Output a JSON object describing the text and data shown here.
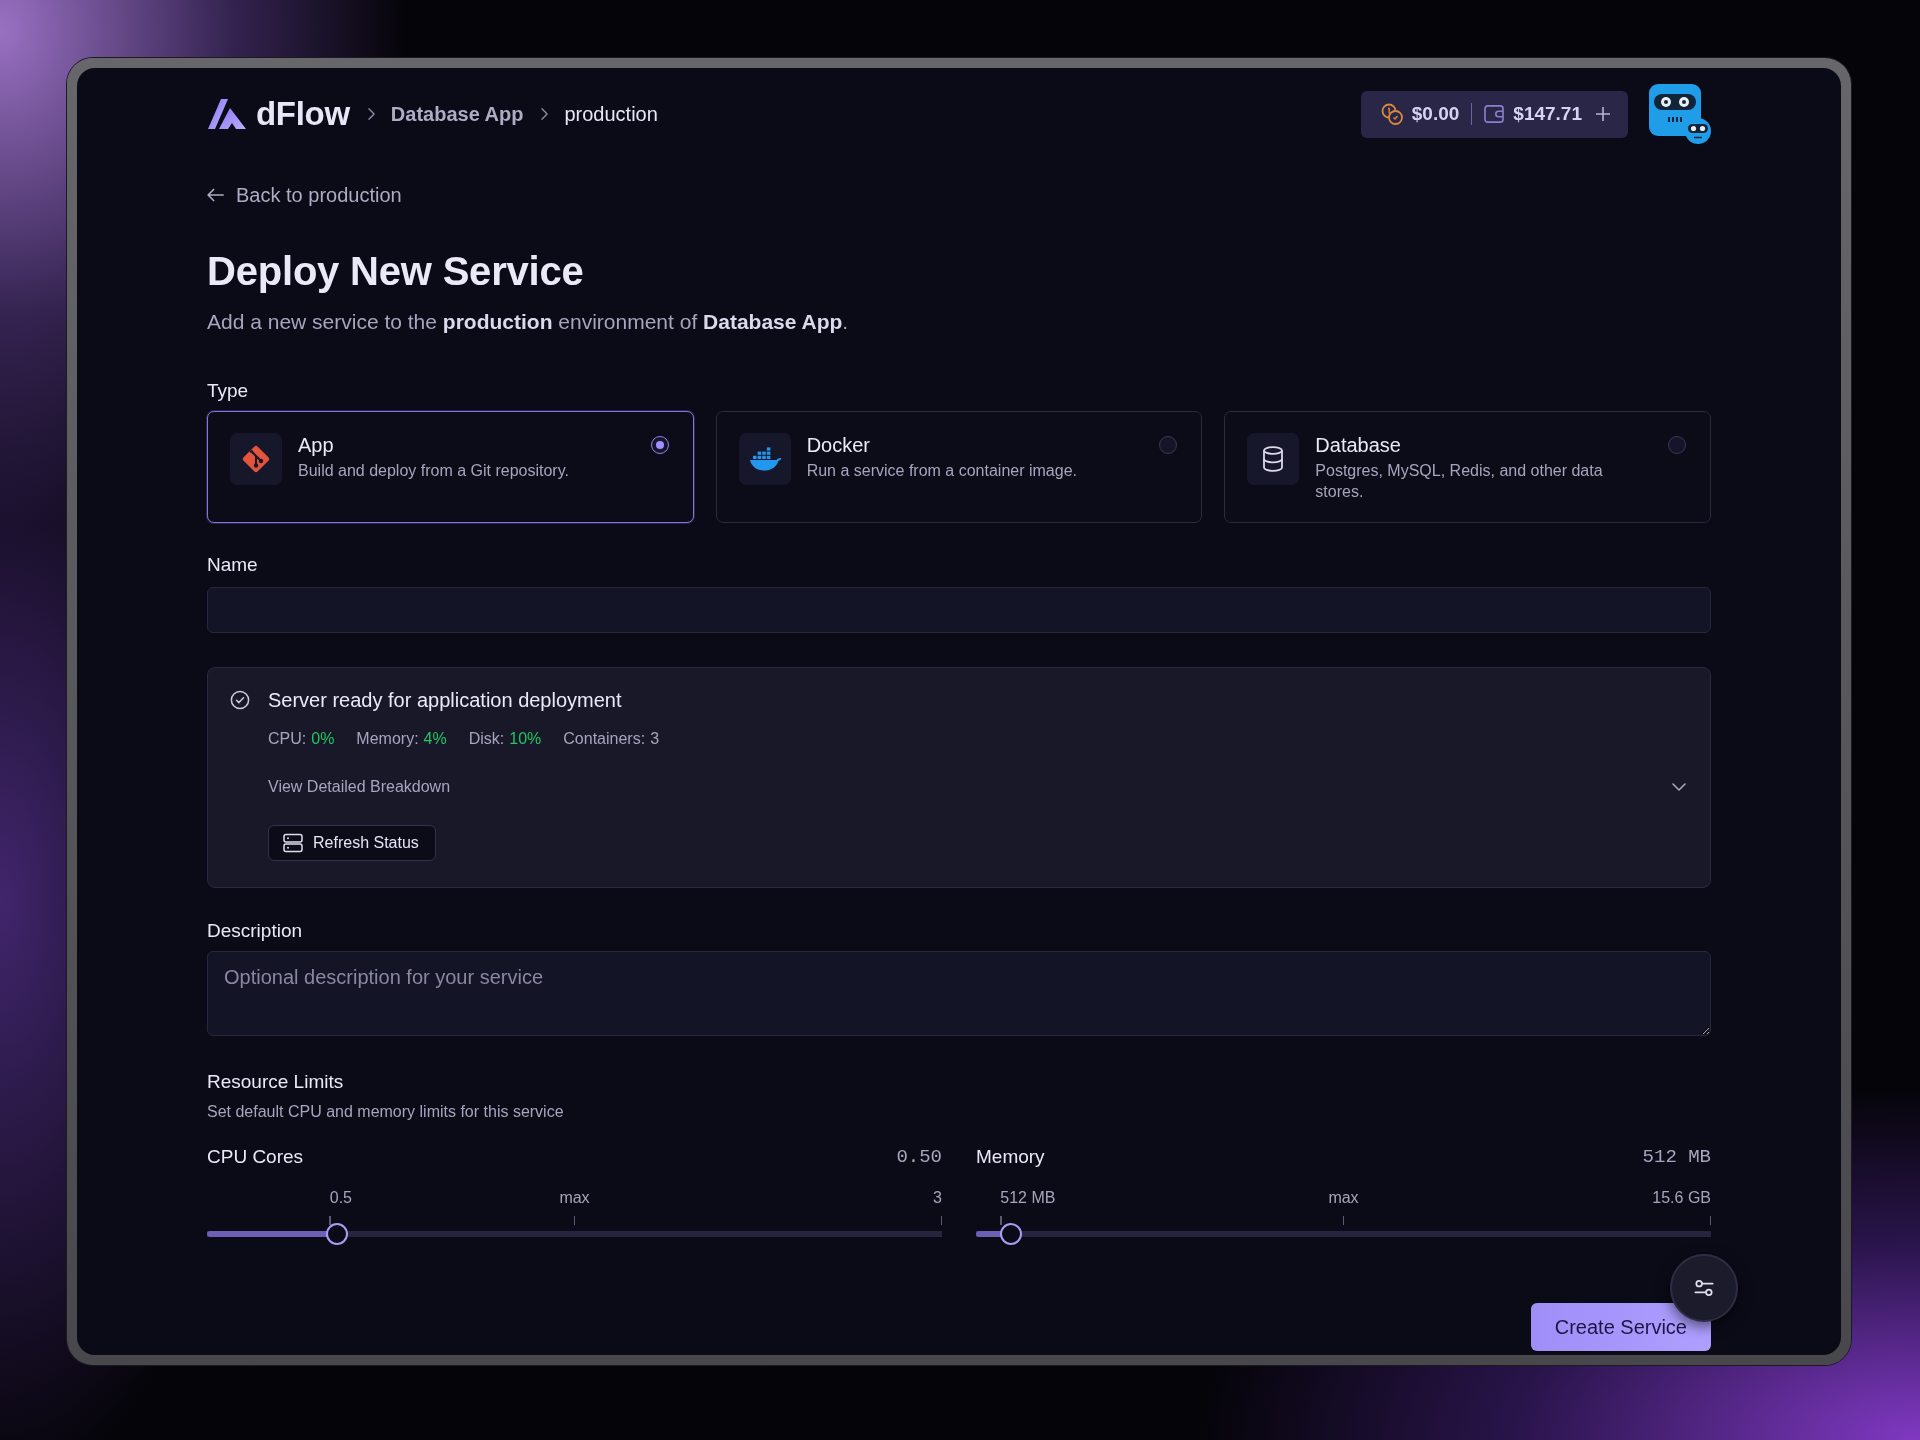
{
  "header": {
    "logo": "dFlow",
    "breadcrumbs": [
      {
        "label": "Database App",
        "current": false
      },
      {
        "label": "production",
        "current": true
      }
    ],
    "balance": {
      "credits": "$0.00",
      "wallet": "$147.71"
    }
  },
  "back_link": "Back to production",
  "page": {
    "title": "Deploy New Service",
    "subtitle": "Add a new service to the **production** environment of **Database App**."
  },
  "service_type": {
    "label": "Type",
    "options": [
      {
        "kind": "git",
        "title": "App",
        "description": "Build and deploy from a Git repository.",
        "selected": true
      },
      {
        "kind": "docker",
        "title": "Docker",
        "description": "Run a service from a container image.",
        "selected": false
      },
      {
        "kind": "database",
        "title": "Database",
        "description": "Postgres, MySQL, Redis, and other data stores.",
        "selected": false
      }
    ]
  },
  "name_field": {
    "label": "Name"
  },
  "server_status": {
    "title": "Server ready for application deployment",
    "metrics": [
      {
        "label": "CPU:",
        "value": "0%",
        "color": "#22c55e"
      },
      {
        "label": "Memory:",
        "value": "4%",
        "color": "#22c55e"
      },
      {
        "label": "Disk:",
        "value": "10%",
        "color": "#22c55e"
      },
      {
        "label": "Containers:",
        "value": "3",
        "color": "#a7a4bd"
      }
    ],
    "details_toggle": "View Detailed Breakdown",
    "expanded": false,
    "refresh_button": "Refresh Status"
  },
  "description_field": {
    "label": "Description",
    "placeholder": "Optional description for your service"
  },
  "resource_limits": {
    "title": "Resource Limits",
    "subtitle": "Set default CPU and memory limits for this service",
    "sliders": [
      {
        "label": "CPU Cores",
        "reading": "0.50",
        "level": 0.167,
        "ticks": [
          "0.5",
          "max",
          "3"
        ]
      },
      {
        "label": "Memory",
        "reading": "512 MB",
        "level": 0.033,
        "ticks": [
          "512 MB",
          "max",
          "15.6 GB"
        ]
      }
    ]
  },
  "create_button": "Create Service"
}
